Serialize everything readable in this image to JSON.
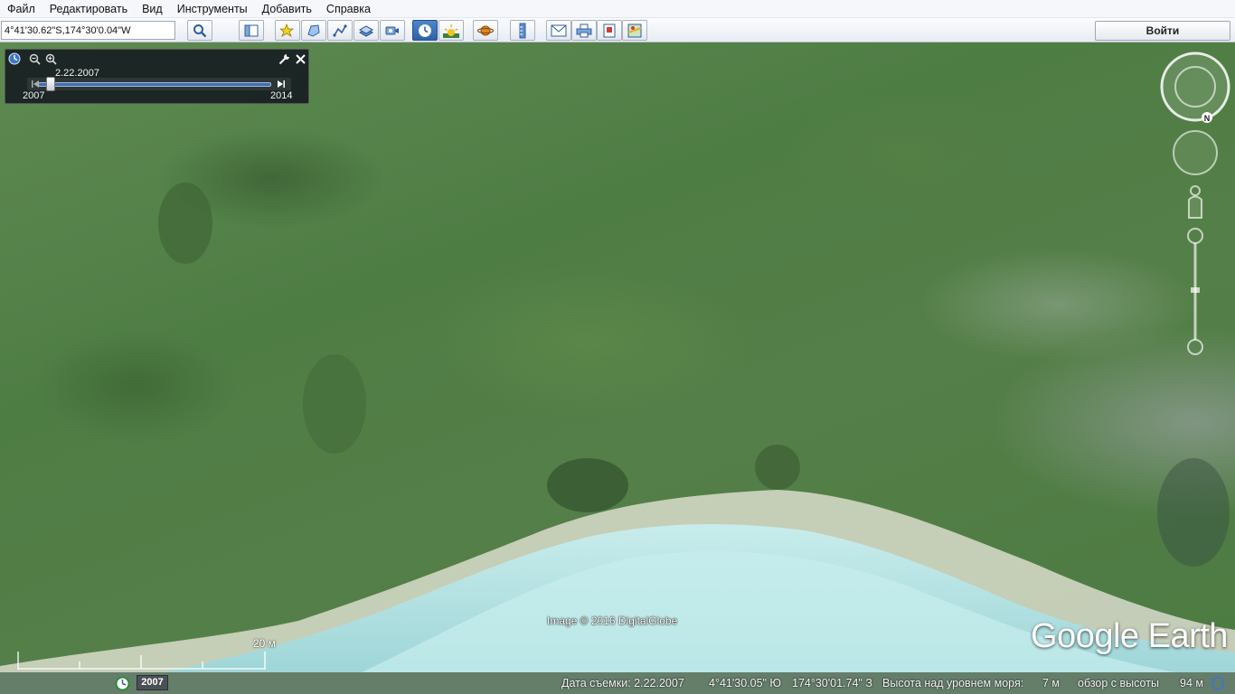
{
  "menu": {
    "items": [
      "Файл",
      "Редактировать",
      "Вид",
      "Инструменты",
      "Добавить",
      "Справка"
    ]
  },
  "search": {
    "value": "4°41'30.62\"S,174°30'0.04\"W"
  },
  "toolbar": {
    "buttons": [
      {
        "name": "search-button",
        "icon": "magnifier-icon"
      },
      {
        "name": "sidebar-toggle-button",
        "icon": "sidebar-icon"
      },
      {
        "name": "add-placemark-button",
        "icon": "pushpin-icon"
      },
      {
        "name": "add-polygon-button",
        "icon": "polygon-icon"
      },
      {
        "name": "add-path-button",
        "icon": "path-icon"
      },
      {
        "name": "add-image-overlay-button",
        "icon": "image-overlay-icon"
      },
      {
        "name": "record-tour-button",
        "icon": "record-tour-icon"
      },
      {
        "name": "historical-imagery-button",
        "icon": "clock-icon",
        "active": true
      },
      {
        "name": "sunlight-button",
        "icon": "sun-icon"
      },
      {
        "name": "switch-planet-button",
        "icon": "planet-icon"
      },
      {
        "name": "ruler-button",
        "icon": "ruler-icon"
      },
      {
        "name": "email-button",
        "icon": "envelope-icon"
      },
      {
        "name": "print-button",
        "icon": "printer-icon"
      },
      {
        "name": "save-image-button",
        "icon": "save-image-icon"
      },
      {
        "name": "view-in-maps-button",
        "icon": "map-icon"
      }
    ],
    "login_label": "Войти"
  },
  "time_slider": {
    "current_date": "2.22.2007",
    "start_year": "2007",
    "end_year": "2014",
    "position_fraction": 0.0
  },
  "map": {
    "attribution": "Image © 2016 DigitalGlobe",
    "logo": "Google Earth",
    "scale_label": "20 м"
  },
  "status": {
    "year_badge": "2007",
    "imagery_date": "Дата съемки: 2.22.2007",
    "latitude": "4°41'30.05\" Ю",
    "longitude": "174°30'01.74\" З",
    "elevation_label": "Высота над уровнем моря:",
    "elevation_value": "7 м",
    "eye_alt_label": "обзор с высоты",
    "eye_alt_value": "94 м"
  },
  "colors": {
    "accent": "#2e62a8",
    "vegetation": "#4e7d44",
    "water": "#bfe6e6"
  }
}
